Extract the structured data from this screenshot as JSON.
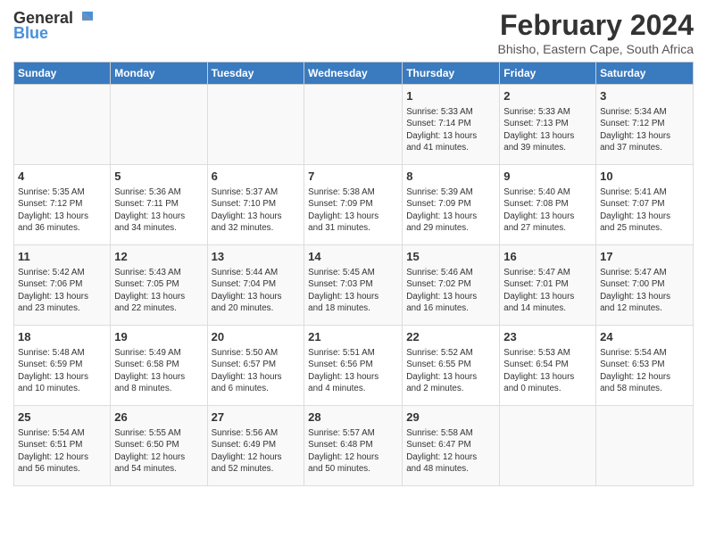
{
  "logo": {
    "general": "General",
    "blue": "Blue"
  },
  "title": "February 2024",
  "subtitle": "Bhisho, Eastern Cape, South Africa",
  "headers": [
    "Sunday",
    "Monday",
    "Tuesday",
    "Wednesday",
    "Thursday",
    "Friday",
    "Saturday"
  ],
  "weeks": [
    [
      {
        "day": "",
        "content": ""
      },
      {
        "day": "",
        "content": ""
      },
      {
        "day": "",
        "content": ""
      },
      {
        "day": "",
        "content": ""
      },
      {
        "day": "1",
        "content": "Sunrise: 5:33 AM\nSunset: 7:14 PM\nDaylight: 13 hours\nand 41 minutes."
      },
      {
        "day": "2",
        "content": "Sunrise: 5:33 AM\nSunset: 7:13 PM\nDaylight: 13 hours\nand 39 minutes."
      },
      {
        "day": "3",
        "content": "Sunrise: 5:34 AM\nSunset: 7:12 PM\nDaylight: 13 hours\nand 37 minutes."
      }
    ],
    [
      {
        "day": "4",
        "content": "Sunrise: 5:35 AM\nSunset: 7:12 PM\nDaylight: 13 hours\nand 36 minutes."
      },
      {
        "day": "5",
        "content": "Sunrise: 5:36 AM\nSunset: 7:11 PM\nDaylight: 13 hours\nand 34 minutes."
      },
      {
        "day": "6",
        "content": "Sunrise: 5:37 AM\nSunset: 7:10 PM\nDaylight: 13 hours\nand 32 minutes."
      },
      {
        "day": "7",
        "content": "Sunrise: 5:38 AM\nSunset: 7:09 PM\nDaylight: 13 hours\nand 31 minutes."
      },
      {
        "day": "8",
        "content": "Sunrise: 5:39 AM\nSunset: 7:09 PM\nDaylight: 13 hours\nand 29 minutes."
      },
      {
        "day": "9",
        "content": "Sunrise: 5:40 AM\nSunset: 7:08 PM\nDaylight: 13 hours\nand 27 minutes."
      },
      {
        "day": "10",
        "content": "Sunrise: 5:41 AM\nSunset: 7:07 PM\nDaylight: 13 hours\nand 25 minutes."
      }
    ],
    [
      {
        "day": "11",
        "content": "Sunrise: 5:42 AM\nSunset: 7:06 PM\nDaylight: 13 hours\nand 23 minutes."
      },
      {
        "day": "12",
        "content": "Sunrise: 5:43 AM\nSunset: 7:05 PM\nDaylight: 13 hours\nand 22 minutes."
      },
      {
        "day": "13",
        "content": "Sunrise: 5:44 AM\nSunset: 7:04 PM\nDaylight: 13 hours\nand 20 minutes."
      },
      {
        "day": "14",
        "content": "Sunrise: 5:45 AM\nSunset: 7:03 PM\nDaylight: 13 hours\nand 18 minutes."
      },
      {
        "day": "15",
        "content": "Sunrise: 5:46 AM\nSunset: 7:02 PM\nDaylight: 13 hours\nand 16 minutes."
      },
      {
        "day": "16",
        "content": "Sunrise: 5:47 AM\nSunset: 7:01 PM\nDaylight: 13 hours\nand 14 minutes."
      },
      {
        "day": "17",
        "content": "Sunrise: 5:47 AM\nSunset: 7:00 PM\nDaylight: 13 hours\nand 12 minutes."
      }
    ],
    [
      {
        "day": "18",
        "content": "Sunrise: 5:48 AM\nSunset: 6:59 PM\nDaylight: 13 hours\nand 10 minutes."
      },
      {
        "day": "19",
        "content": "Sunrise: 5:49 AM\nSunset: 6:58 PM\nDaylight: 13 hours\nand 8 minutes."
      },
      {
        "day": "20",
        "content": "Sunrise: 5:50 AM\nSunset: 6:57 PM\nDaylight: 13 hours\nand 6 minutes."
      },
      {
        "day": "21",
        "content": "Sunrise: 5:51 AM\nSunset: 6:56 PM\nDaylight: 13 hours\nand 4 minutes."
      },
      {
        "day": "22",
        "content": "Sunrise: 5:52 AM\nSunset: 6:55 PM\nDaylight: 13 hours\nand 2 minutes."
      },
      {
        "day": "23",
        "content": "Sunrise: 5:53 AM\nSunset: 6:54 PM\nDaylight: 13 hours\nand 0 minutes."
      },
      {
        "day": "24",
        "content": "Sunrise: 5:54 AM\nSunset: 6:53 PM\nDaylight: 12 hours\nand 58 minutes."
      }
    ],
    [
      {
        "day": "25",
        "content": "Sunrise: 5:54 AM\nSunset: 6:51 PM\nDaylight: 12 hours\nand 56 minutes."
      },
      {
        "day": "26",
        "content": "Sunrise: 5:55 AM\nSunset: 6:50 PM\nDaylight: 12 hours\nand 54 minutes."
      },
      {
        "day": "27",
        "content": "Sunrise: 5:56 AM\nSunset: 6:49 PM\nDaylight: 12 hours\nand 52 minutes."
      },
      {
        "day": "28",
        "content": "Sunrise: 5:57 AM\nSunset: 6:48 PM\nDaylight: 12 hours\nand 50 minutes."
      },
      {
        "day": "29",
        "content": "Sunrise: 5:58 AM\nSunset: 6:47 PM\nDaylight: 12 hours\nand 48 minutes."
      },
      {
        "day": "",
        "content": ""
      },
      {
        "day": "",
        "content": ""
      }
    ]
  ]
}
